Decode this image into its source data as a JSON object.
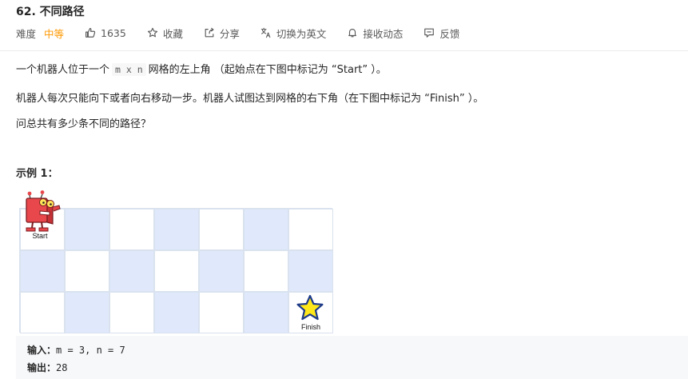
{
  "problem": {
    "title": "62. 不同路径"
  },
  "meta": {
    "difficulty_label": "难度",
    "difficulty_value": "中等",
    "likes": "1635",
    "favorite": "收藏",
    "share": "分享",
    "switch_language": "切换为英文",
    "subscribe": "接收动态",
    "feedback": "反馈"
  },
  "description": {
    "p1_before": "一个机器人位于一个",
    "p1_code": "m x n",
    "p1_after": "网格的左上角 （起始点在下图中标记为 “Start” ）。",
    "p2": "机器人每次只能向下或者向右移动一步。机器人试图达到网格的右下角（在下图中标记为 “Finish” ）。",
    "p3": "问总共有多少条不同的路径？"
  },
  "example": {
    "title": "示例 1：",
    "start_label": "Start",
    "finish_label": "Finish",
    "input_label": "输入：",
    "input_value": "m = 3, n = 7",
    "output_label": "输出：",
    "output_value": "28"
  },
  "colors": {
    "difficulty": "#ff9800",
    "grid_blue": "#dfe9fb",
    "grid_line": "#d9e2ee",
    "star_fill": "#ffe81a",
    "star_stroke": "#1c3a8a",
    "robot_red": "#e8474c"
  },
  "icons": [
    "thumbs-up-icon",
    "star-icon",
    "share-icon",
    "translate-icon",
    "bell-icon",
    "feedback-icon"
  ]
}
